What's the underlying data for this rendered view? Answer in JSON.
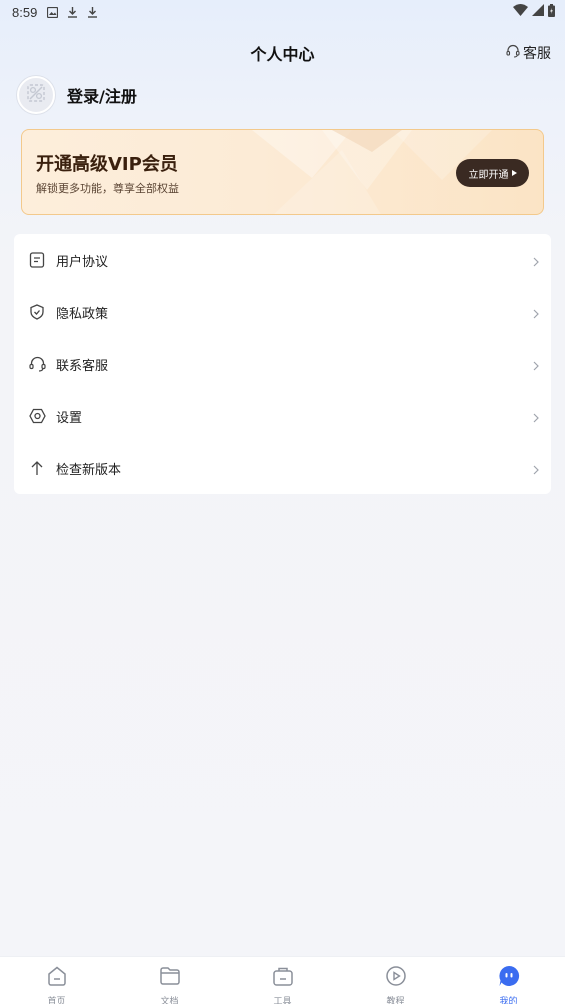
{
  "status_bar": {
    "time": "8:59",
    "left_icons": [
      "photo-notification-icon",
      "download-icon",
      "download-icon"
    ],
    "right_icons": [
      "wifi-icon",
      "signal-icon",
      "battery-icon"
    ]
  },
  "header": {
    "title": "个人中心",
    "service_label": "客服",
    "service_icon": "headset-icon"
  },
  "profile": {
    "login_label": "登录/注册",
    "avatar_icon": "avatar-placeholder-icon"
  },
  "vip": {
    "title": "开通高级VIP会员",
    "subtitle": "解锁更多功能，尊享全部权益",
    "button_label": "立即开通"
  },
  "menu": {
    "items": [
      {
        "label": "用户协议",
        "icon": "document-icon"
      },
      {
        "label": "隐私政策",
        "icon": "shield-check-icon"
      },
      {
        "label": "联系客服",
        "icon": "headset-icon"
      },
      {
        "label": "设置",
        "icon": "settings-icon"
      },
      {
        "label": "检查新版本",
        "icon": "arrow-up-icon"
      }
    ]
  },
  "bottom_nav": {
    "items": [
      {
        "label": "首页",
        "icon": "home-icon",
        "active": false
      },
      {
        "label": "文档",
        "icon": "folder-icon",
        "active": false
      },
      {
        "label": "工具",
        "icon": "toolbox-icon",
        "active": false
      },
      {
        "label": "教程",
        "icon": "play-icon",
        "active": false
      },
      {
        "label": "我的",
        "icon": "profile-icon",
        "active": true
      }
    ]
  },
  "colors": {
    "accent": "#3a6cf0",
    "vip_border": "#f3c98c",
    "vip_button": "#3a2a22"
  }
}
